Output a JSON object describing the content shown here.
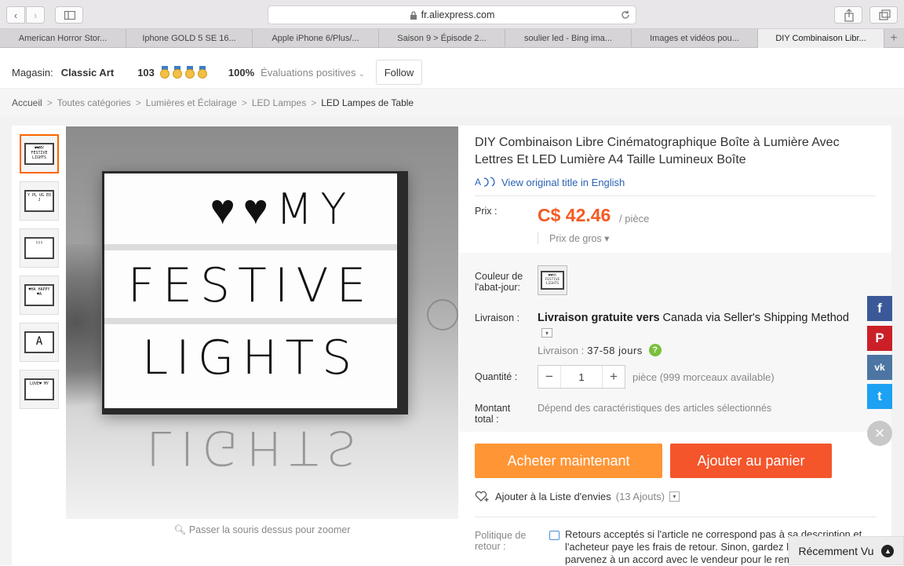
{
  "browser": {
    "url": "fr.aliexpress.com",
    "tabs": [
      {
        "label": "American Horror Stor..."
      },
      {
        "label": "Iphone GOLD 5 SE 16..."
      },
      {
        "label": "Apple iPhone 6/Plus/..."
      },
      {
        "label": "Saison 9 > Épisode 2..."
      },
      {
        "label": "soulier led - Bing ima..."
      },
      {
        "label": "Images et vidéos pou..."
      },
      {
        "label": "DIY Combinaison Libr..."
      }
    ],
    "new_tab": "+"
  },
  "store": {
    "label": "Magasin:",
    "name": "Classic Art",
    "score": "103",
    "positive_pct": "100%",
    "positive_label": "Évaluations positives",
    "follow": "Follow"
  },
  "breadcrumb": {
    "items": [
      "Accueil",
      "Toutes catégories",
      "Lumières et Éclairage",
      "LED Lampes",
      "LED Lampes de Table"
    ],
    "separator": ">"
  },
  "gallery": {
    "lightbox_lines": [
      "♥♥MY",
      "FESTIVE",
      "LIGHTS"
    ],
    "thumbnails": [
      {
        "text": "♥♥MY FESTIVE LIGHTS"
      },
      {
        "text": "Y PL UG EO J"
      },
      {
        "text": "▯▯▯"
      },
      {
        "text": "♥HA HAPPY ♥A"
      },
      {
        "text": "A"
      },
      {
        "text": "LOVE♥ MY"
      }
    ],
    "zoom_hint": "Passer la souris dessus pour zoomer"
  },
  "product": {
    "title": "DIY Combinaison Libre Cinématographique Boîte à Lumière Avec Lettres Et LED Lumière A4 Taille Lumineux Boîte",
    "view_original": "View original title in English",
    "price_label": "Prix :",
    "price": "C$ 42.46",
    "per_unit": "/ pièce",
    "wholesale": "Prix de gros ▾",
    "color_label": "Couleur de l'abat-jour:",
    "shipping_label": "Livraison :",
    "shipping_free": "Livraison gratuite vers",
    "shipping_dest": " Canada via Seller's Shipping Method",
    "delivery_label": "Livraison :",
    "delivery_days": "37-58 jours",
    "quantity_label": "Quantité :",
    "quantity": "1",
    "quantity_avail": "pièce (999 morceaux available)",
    "total_label": "Montant total :",
    "total_value": "Dépend des caractéristiques des articles sélectionnés",
    "buy_now": "Acheter maintenant",
    "add_cart": "Ajouter au panier",
    "wishlist": "Ajouter à la Liste d'envies",
    "wishlist_count": "(13 Ajouts)",
    "return_label": "Politique de retour :",
    "return_text": "Retours acceptés si l'article ne correspond pas à sa description et l'acheteur paye les frais de retour. Sinon, gardez le produit si vous parvenez à un accord avec le vendeur pour le remboursement."
  },
  "social": {
    "facebook": "f",
    "pinterest": "P",
    "vk": "vk",
    "twitter": "t",
    "close": "×"
  },
  "recent": {
    "label": "Récemment Vu"
  },
  "colors": {
    "accent": "#f45b22",
    "buy": "#ff9535",
    "link": "#2a62b3"
  }
}
